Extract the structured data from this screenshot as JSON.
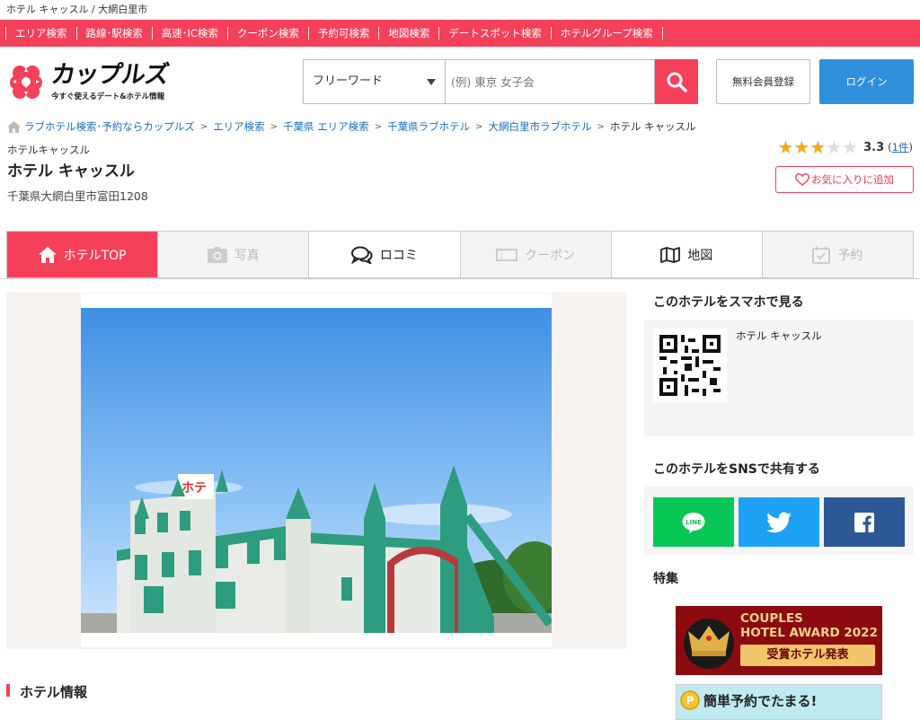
{
  "topline": {
    "text": "ホテル キャッスル / 大網白里市"
  },
  "nav": {
    "items": [
      "エリア検索",
      "路線･駅検索",
      "高速･IC検索",
      "クーポン検索",
      "予約可検索",
      "地図検索",
      "デートスポット検索",
      "ホテルグループ検索"
    ]
  },
  "header": {
    "logo_title": "カップルズ",
    "logo_sub": "今すぐ使えるデート&ホテル情報",
    "search_select": "フリーワード",
    "search_placeholder": "(例) 東京 女子会",
    "register_label": "無料会員登録",
    "login_label": "ログイン"
  },
  "breadcrumb": {
    "items": [
      "ラブホテル検索･予約ならカップルズ",
      "エリア検索",
      "千葉県 エリア検索",
      "千葉県ラブホテル",
      "大網白里市ラブホテル"
    ],
    "current": "ホテル キャッスル"
  },
  "hotel": {
    "kana": "ホテルキャッスル",
    "name": "ホテル キャッスル",
    "address": "千葉県大網白里市富田1208",
    "rating": 3.3,
    "rating_text": "3.3",
    "review_count_prefix": "(",
    "review_count": "1件",
    "review_count_suffix": ")",
    "favorite_label": "お気に入りに追加"
  },
  "tabs": [
    {
      "label": "ホテルTOP",
      "state": "active",
      "icon": "home-icon"
    },
    {
      "label": "写真",
      "state": "disabled",
      "icon": "camera-icon"
    },
    {
      "label": "ロコミ",
      "state": "normal",
      "icon": "chat-icon"
    },
    {
      "label": "クーポン",
      "state": "disabled",
      "icon": "coupon-icon"
    },
    {
      "label": "地図",
      "state": "normal",
      "icon": "map-icon"
    },
    {
      "label": "予約",
      "state": "disabled",
      "icon": "calendar-icon"
    }
  ],
  "sidebar": {
    "qr_heading": "このホテルをスマホで見る",
    "qr_hotel_name": "ホテル キャッスル",
    "share_heading": "このホテルをSNSで共有する",
    "line_label": "LINE",
    "feature_heading": "特集",
    "banner1_line1": "COUPLES",
    "banner1_line2": "HOTEL AWARD 2022",
    "banner1_button": "受賞ホテル発表",
    "banner2_text": "簡単予約でたまる!"
  },
  "section": {
    "title": "ホテル情報"
  },
  "colors": {
    "brand": "#f5405a",
    "link": "#1a6fc0",
    "login": "#2f8fdc",
    "line": "#06c755",
    "twitter": "#1da1f2",
    "facebook": "#2d5896"
  }
}
